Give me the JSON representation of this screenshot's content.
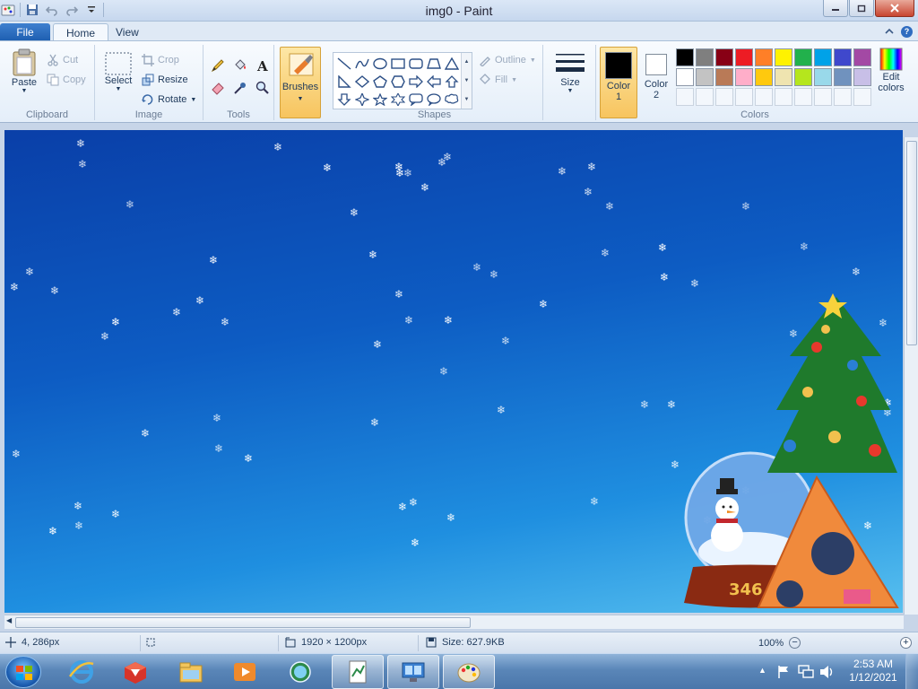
{
  "window": {
    "title": "img0 - Paint"
  },
  "tabs": [
    {
      "label": "File"
    },
    {
      "label": "Home"
    },
    {
      "label": "View"
    }
  ],
  "ribbon": {
    "clipboard": {
      "group_label": "Clipboard",
      "paste": "Paste",
      "cut": "Cut",
      "copy": "Copy"
    },
    "image": {
      "group_label": "Image",
      "select": "Select",
      "crop": "Crop",
      "resize": "Resize",
      "rotate": "Rotate"
    },
    "tools": {
      "group_label": "Tools"
    },
    "brushes": {
      "label": "Brushes"
    },
    "shapes": {
      "group_label": "Shapes",
      "outline": "Outline",
      "fill": "Fill"
    },
    "size": {
      "label": "Size"
    },
    "colors": {
      "group_label": "Colors",
      "color1_label": "Color 1",
      "color2_label": "Color 2",
      "edit_colors_label": "Edit colors",
      "color1": "#000000",
      "color2": "#ffffff",
      "palette": [
        "#000000",
        "#7f7f7f",
        "#880015",
        "#ed1c24",
        "#ff7f27",
        "#fff200",
        "#22b14c",
        "#00a2e8",
        "#3f48cc",
        "#a349a4",
        "#ffffff",
        "#c3c3c3",
        "#b97a57",
        "#ffaec9",
        "#ffc90e",
        "#efe4b0",
        "#b5e61d",
        "#99d9ea",
        "#7092be",
        "#c8bfe7"
      ]
    }
  },
  "statusbar": {
    "cursor_position": "4, 286px",
    "image_size": "1920 × 1200px",
    "file_size": "Size: 627.9KB",
    "zoom": "100%"
  },
  "canvas": {
    "image_text": "346"
  },
  "taskbar": {
    "clock_time": "2:53 AM",
    "clock_date": "1/12/2021",
    "items": [
      "internet-explorer",
      "app-red-cube",
      "file-explorer",
      "media-player",
      "globe-app",
      "notepad-app",
      "remote-app",
      "paint-app"
    ]
  }
}
